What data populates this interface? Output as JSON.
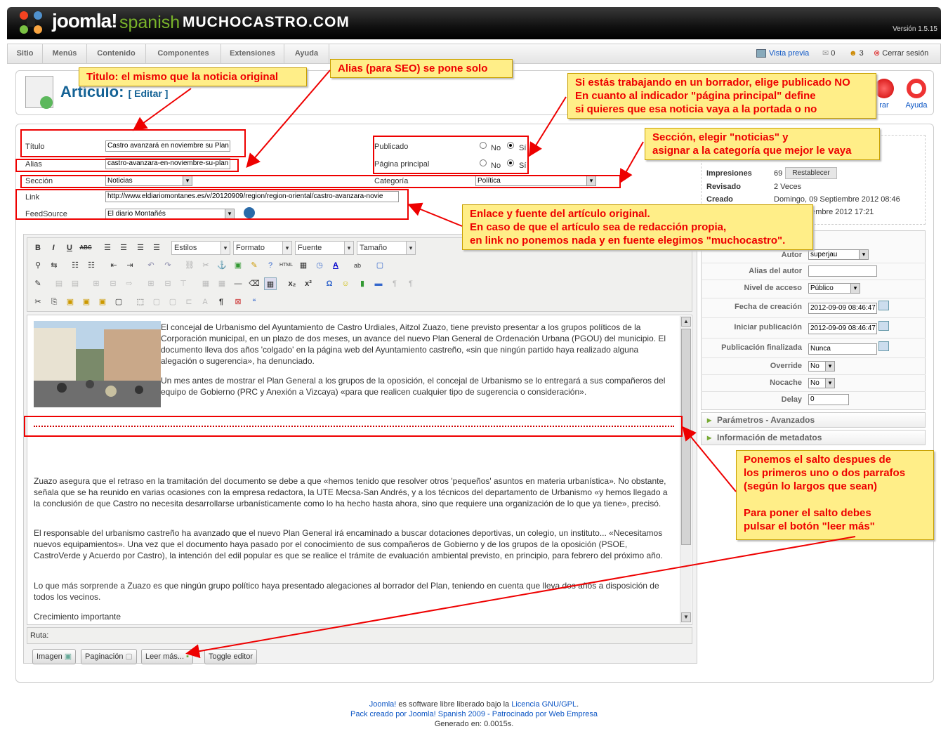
{
  "header": {
    "logo_text": "joomla!",
    "logo_sub": "spanish",
    "site_name": "MUCHOCASTRO.COM",
    "version": "Versión 1.5.15"
  },
  "menu": [
    "Sitio",
    "Menús",
    "Contenido",
    "Componentes",
    "Extensiones",
    "Ayuda"
  ],
  "top_right": {
    "preview": "Vista previa",
    "messages": "0",
    "users": "3",
    "logout": "Cerrar sesión"
  },
  "page": {
    "title": "Artículo:",
    "subtitle": "[ Editar ]"
  },
  "toolbar": {
    "close": "rar",
    "help": "Ayuda"
  },
  "form": {
    "titulo_label": "Título",
    "titulo_value": "Castro avanzará en noviembre su Plan",
    "alias_label": "Alias",
    "alias_value": "castro-avanzara-en-noviembre-su-plan",
    "seccion_label": "Sección",
    "seccion_value": "Noticias",
    "link_label": "Link",
    "link_value": "http://www.eldiariomontanes.es/v/20120909/region/region-oriental/castro-avanzara-novie",
    "feed_label": "FeedSource",
    "feed_value": "El diario Montañés",
    "publicado_label": "Publicado",
    "portada_label": "Página principal",
    "no": "No",
    "si": "Sí",
    "categoria_label": "Categoría",
    "categoria_value": "Política"
  },
  "info": {
    "impresiones_label": "Impresiones",
    "impresiones_value": "69",
    "reset": "Restablecer",
    "revisado_label": "Revisado",
    "revisado_value": "2 Veces",
    "creado_label": "Creado",
    "creado_value": "Domingo, 09 Septiembre 2012 08:46",
    "modificado_value": "Septiembre 2012 17:21"
  },
  "params": {
    "autor_label": "Autor",
    "autor_value": "superjau",
    "alias_autor_label": "Alias del autor",
    "nivel_label": "Nivel de acceso",
    "nivel_value": "Público",
    "fecha_label": "Fecha de creación",
    "fecha_value": "2012-09-09 08:46:47",
    "iniciar_label": "Iniciar publicación",
    "iniciar_value": "2012-09-09 08:46:47",
    "fin_label": "Publicación finalizada",
    "fin_value": "Nunca",
    "override_label": "Override",
    "override_value": "No",
    "nocache_label": "Nocache",
    "nocache_value": "No",
    "delay_label": "Delay",
    "delay_value": "0",
    "adv": "Parámetros - Avanzados",
    "meta": "Información de metadatos"
  },
  "editor": {
    "estilos": "Estilos",
    "formato": "Formato",
    "fuente": "Fuente",
    "tamano": "Tamaño",
    "p1": "El concejal de Urbanismo del Ayuntamiento de Castro Urdiales, Aitzol Zuazo, tiene previsto presentar a los grupos políticos de la Corporación municipal, en un plazo de dos meses, un avance del nuevo Plan General de Ordenación Urbana (PGOU) del municipio. El documento lleva dos años 'colgado' en la página web del Ayuntamiento castreño, «sin que ningún partido haya realizado alguna alegación o sugerencia», ha denunciado.",
    "p2": "Un mes antes de mostrar el Plan General a los grupos de la oposición, el concejal de Urbanismo se lo entregará a sus compañeros del equipo de Gobierno (PRC y Anexión a Vizcaya) «para que realicen cualquier tipo de sugerencia o consideración».",
    "p3": "Zuazo asegura que el retraso en la tramitación del documento se debe a que «hemos tenido que resolver otros 'pequeños' asuntos en materia urbanística». No obstante, señala que se ha reunido en varias ocasiones con la empresa redactora, la UTE Mecsa-San Andrés, y a los técnicos del departamento de Urbanismo «y hemos llegado a la conclusión de que Castro no necesita desarrollarse urbanísticamente como lo ha hecho hasta ahora, sino que requiere una organización de lo que ya tiene», precisó.",
    "p4": "El responsable del urbanismo castreño ha avanzado que el nuevo Plan General irá encaminado a buscar dotaciones deportivas, un colegio, un instituto... «Necesitamos nuevos equipamientos». Una vez que el documento haya pasado por el conocimiento de sus compañeros de Gobierno y de los grupos de la oposición (PSOE, CastroVerde y Acuerdo por Castro), la intención del edil popular es que se realice el trámite de evaluación ambiental previsto, en principio, para febrero del próximo año.",
    "p5": "Lo que más sorprende a Zuazo es que ningún grupo político haya presentado alegaciones al borrador del Plan, teniendo en cuenta que lleva dos años a disposición de todos los vecinos.",
    "p6": "Crecimiento importante",
    "ruta": "Ruta:",
    "btn_imagen": "Imagen",
    "btn_paginacion": "Paginación",
    "btn_leer": "Leer más...",
    "btn_toggle": "Toggle editor"
  },
  "notes": {
    "n1": "Titulo: el mismo que la noticia original",
    "n2": "Alias (para SEO) se pone solo",
    "n3a": "Si estás trabajando en un borrador, elige publicado NO",
    "n3b": "En cuanto al indicador \"página principal\" define",
    "n3c": "si quieres que esa noticia vaya a la portada o no",
    "n4a": "Sección, elegir \"noticias\" y",
    "n4b": "asignar a la categoría que mejor le vaya",
    "n5a": "Enlace y fuente del artículo original.",
    "n5b": "En caso de que el artículo sea de redacción propia,",
    "n5c": "en link no ponemos nada y en fuente elegimos \"muchocastro\".",
    "n6a": "Ponemos el salto despues de",
    "n6b": "los primeros uno o dos parrafos",
    "n6c": "(según lo largos que sean)",
    "n6d": "Para poner el salto debes",
    "n6e": "pulsar el botón \"leer más\""
  },
  "footer": {
    "l1a": "Joomla!",
    "l1b": " es software libre liberado bajo la ",
    "l1c": "Licencia GNU/GPL",
    "l2": "Pack creado por Joomla! Spanish 2009 - Patrocinado por Web Empresa",
    "l3": "Generado en: 0.0015s."
  }
}
